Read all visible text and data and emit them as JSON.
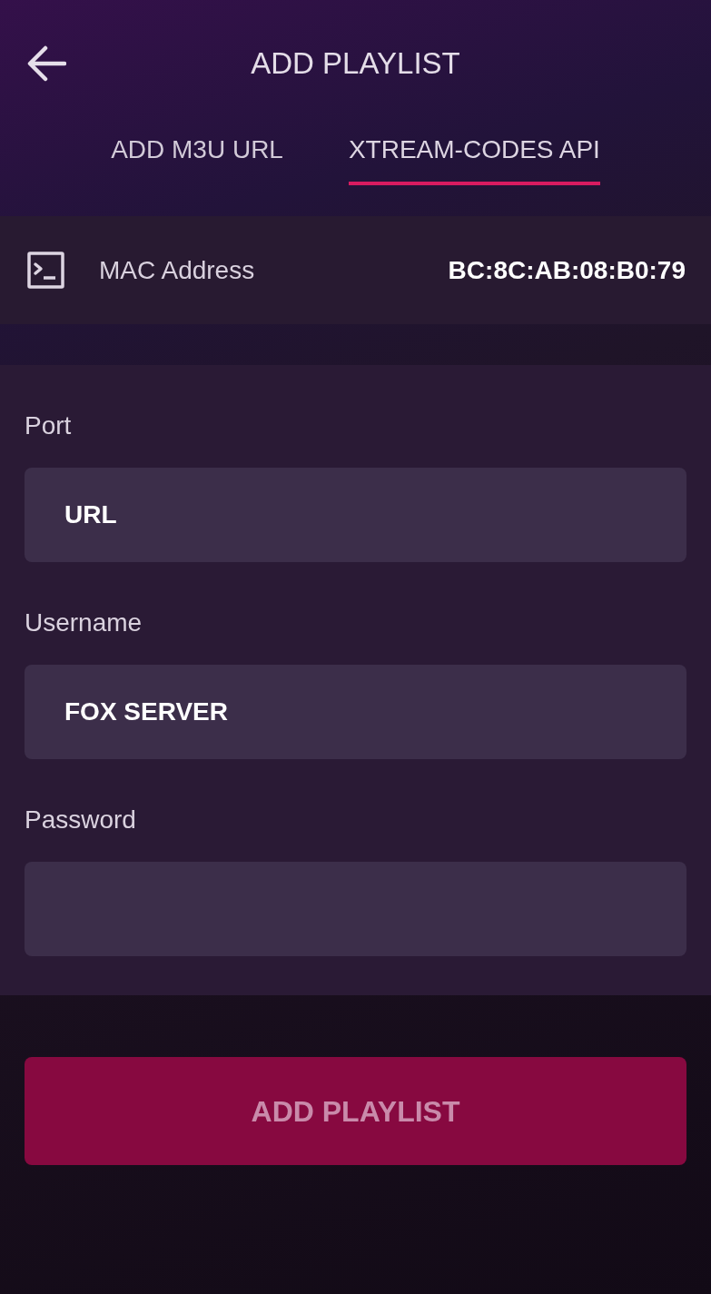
{
  "header": {
    "title": "ADD PLAYLIST"
  },
  "tabs": [
    {
      "label": "ADD M3U URL",
      "selected": false
    },
    {
      "label": "XTREAM-CODES API",
      "selected": true
    }
  ],
  "mac": {
    "label": "MAC Address",
    "value": "BC:8C:AB:08:B0:79"
  },
  "fields": [
    {
      "label": "Port",
      "value": "URL"
    },
    {
      "label": "Username",
      "value": "FOX SERVER"
    },
    {
      "label": "Password"
    }
  ],
  "submit": {
    "label": "ADD PLAYLIST",
    "disabled": true
  }
}
